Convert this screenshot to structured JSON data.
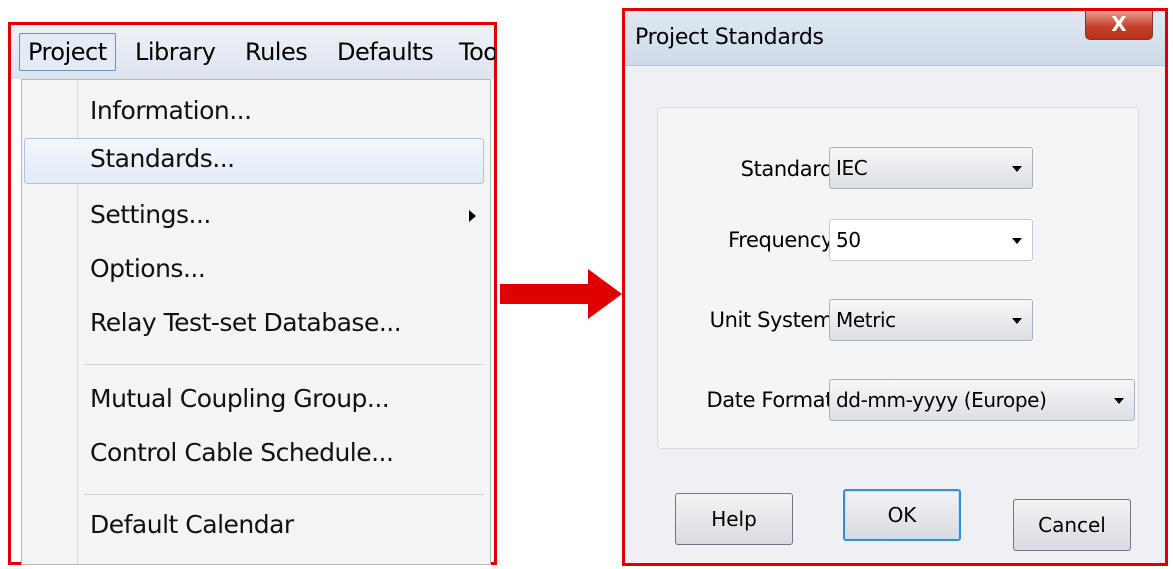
{
  "menubar": {
    "items": [
      "Project",
      "Library",
      "Rules",
      "Defaults",
      "Too"
    ]
  },
  "project_menu": {
    "items": [
      "Information...",
      "Standards...",
      "Settings...",
      "Options...",
      "Relay Test-set Database...",
      "Mutual Coupling Group...",
      "Control Cable Schedule...",
      "Default Calendar"
    ],
    "highlighted": "Standards..."
  },
  "dialog": {
    "title": "Project Standards",
    "close_glyph": "X",
    "fields": [
      {
        "label": "Standard",
        "value": "IEC"
      },
      {
        "label": "Frequency",
        "value": "50"
      },
      {
        "label": "Unit System",
        "value": "Metric"
      },
      {
        "label": "Date Format",
        "value": "dd-mm-yyyy (Europe)"
      }
    ],
    "buttons": {
      "help": "Help",
      "ok": "OK",
      "cancel": "Cancel"
    }
  },
  "colors": {
    "highlight_border": "#e00000",
    "arrow": "#e00000",
    "ok_focus": "#3a8ad6"
  }
}
